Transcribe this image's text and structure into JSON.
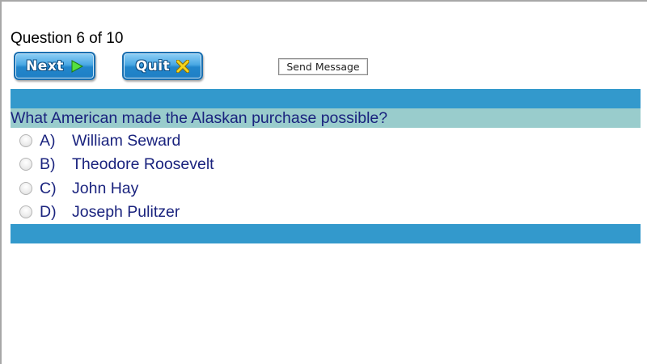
{
  "quiz": {
    "counter": "Question 6 of 10",
    "next_label": "Next",
    "quit_label": "Quit",
    "send_message_label": "Send Message",
    "question": "What American made the Alaskan purchase possible?",
    "options": [
      {
        "letter": "A)",
        "text": "William Seward"
      },
      {
        "letter": "B)",
        "text": "Theodore Roosevelt"
      },
      {
        "letter": "C)",
        "text": "John Hay"
      },
      {
        "letter": "D)",
        "text": "Joseph Pulitzer"
      }
    ]
  },
  "icons": {
    "next": "play-arrow-icon",
    "quit": "x-icon"
  },
  "colors": {
    "header_bar": "#3399cc",
    "question_bar": "#99cccc",
    "question_text": "#1a237e",
    "next_icon": "#55e040",
    "quit_icon": "#f5d41c"
  }
}
